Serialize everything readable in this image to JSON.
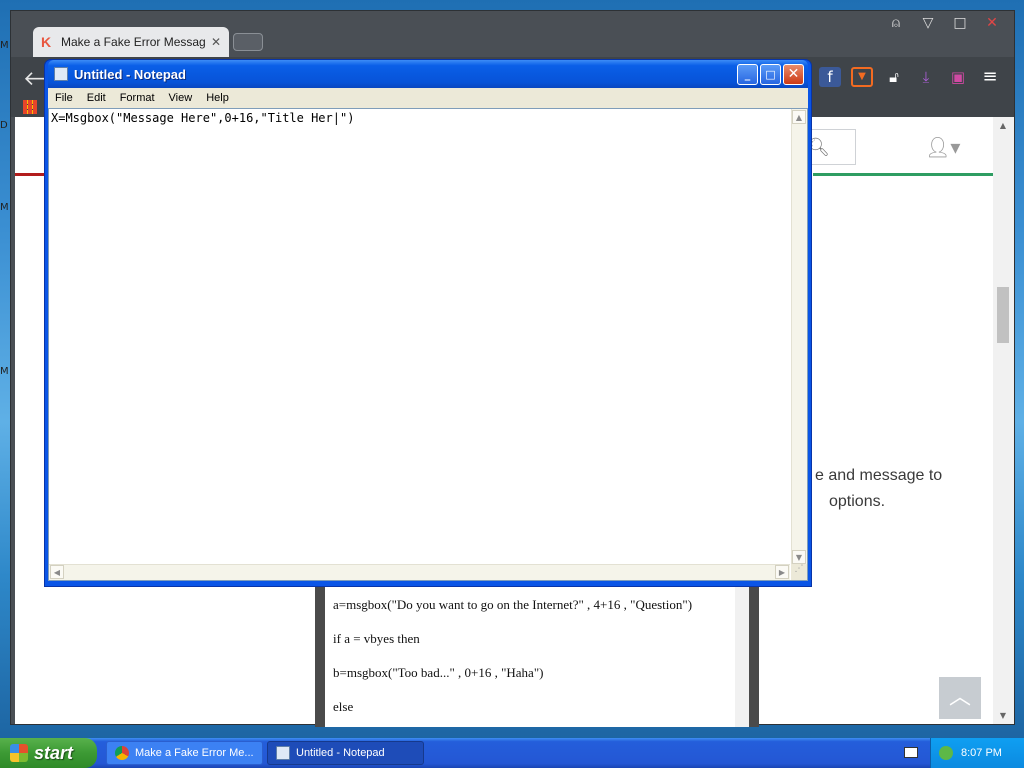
{
  "desktop": {
    "edge_letters": [
      "D",
      "M",
      "M",
      "M"
    ]
  },
  "browser": {
    "tab": {
      "title": "Make a Fake Error Message U",
      "favicon": "K",
      "close": "✕"
    },
    "window_buttons": {
      "profile": "⍝",
      "minimize": "▽",
      "maximize": "□",
      "close": "✕"
    },
    "back": "🡐",
    "extensions": [
      "facebook-icon",
      "youtube-icon",
      "lock-icon",
      "download-icon",
      "tv-icon",
      "menu-icon"
    ],
    "page": {
      "text_line_1": "e and message to",
      "text_line_2": "options.",
      "scroll_top_glyph": "︿",
      "embed_lines": [
        "a=msgbox(\"Do you want to go on the Internet?\" , 4+16 , \"Question\")",
        "if a = vbyes then",
        "b=msgbox(\"Too bad...\" , 0+16 , \"Haha\")",
        "else"
      ]
    }
  },
  "notepad": {
    "title": "Untitled - Notepad",
    "menu": [
      "File",
      "Edit",
      "Format",
      "View",
      "Help"
    ],
    "content": "X=Msgbox(\"Message Here\",0+16,\"Title Her|\")",
    "buttons": {
      "minimize": "_",
      "maximize": "□",
      "close": "✕"
    }
  },
  "taskbar": {
    "start_label": "start",
    "items": [
      {
        "label": "Make a Fake Error Me...",
        "active": false
      },
      {
        "label": "Untitled - Notepad",
        "active": true
      }
    ],
    "clock": "8:07 PM"
  }
}
